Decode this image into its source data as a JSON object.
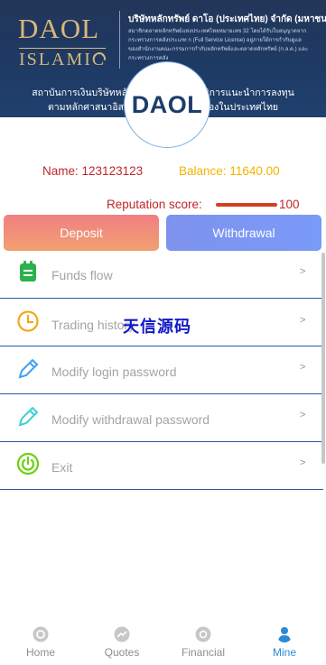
{
  "banner": {
    "logo_top": "DAOL",
    "logo_bottom": "ISLAMIC",
    "company_title": "บริษัทหลักทรัพย์ ดาโอ (ประเทศไทย) จำกัด (มหาชน)",
    "info_lines": [
      "สมาชิกตลาดหลักทรัพย์แห่งประเทศไทยหมายเลข 32 โดยได้รับใบอนุญาตจาก",
      "กระทรวงการคลังประเภท ก (Full Service License) อยู่ภายใต้การกำกับดูแล",
      "ของสำนักงานคณะกรรมการกำกับหลักทรัพย์และตลาดหลักทรัพย์ (ก.ล.ต.) และ",
      "กระทรวงการคลัง"
    ],
    "subline_1": "สถาบันการเงินบริษัทหลักทรัพย์ชั้นนำที่ให้บริการแนะนำการลงทุน",
    "subline_2": "ตามหลักศาสนาอิสลามแห่งแรกที่ได้รับรองในประเทศไทย",
    "circle_logo_text": "DAOL",
    "colors": {
      "navy": "#1e3a64",
      "gold": "#d7b77a"
    }
  },
  "profile": {
    "name_label": "Name:",
    "name_value": "123123123",
    "balance_label": "Balance:",
    "balance_value": "11640.00",
    "reputation_label": "Reputation score:",
    "reputation_value": "100",
    "reputation_fraction": 1.0
  },
  "actions": {
    "deposit_label": "Deposit",
    "withdrawal_label": "Withdrawal"
  },
  "menu": [
    {
      "label": "Funds flow",
      "chevron": ">",
      "icon": "clipboard-icon",
      "color": "#2bb24c"
    },
    {
      "label": "Trading history",
      "chevron": ">",
      "icon": "clock-icon",
      "color": "#f0a81f"
    },
    {
      "label": "Modify login password",
      "chevron": ">",
      "icon": "pencil-icon",
      "color": "#3fa0f0"
    },
    {
      "label": "Modify withdrawal password",
      "chevron": ">",
      "icon": "pencil-icon",
      "color": "#3fd0d0"
    },
    {
      "label": "Exit",
      "chevron": ">",
      "icon": "power-icon",
      "color": "#6ad10f"
    }
  ],
  "watermark": "天信源码",
  "tabs": [
    {
      "label": "Home",
      "icon": "home-icon",
      "active": false
    },
    {
      "label": "Quotes",
      "icon": "quotes-icon",
      "active": false
    },
    {
      "label": "Financial",
      "icon": "financial-icon",
      "active": false
    },
    {
      "label": "Mine",
      "icon": "user-icon",
      "active": true
    }
  ],
  "colors": {
    "name": "#c0262b",
    "balance": "#f5b300",
    "accent_blue": "#2a8ad8",
    "divider": "#245b9c"
  }
}
